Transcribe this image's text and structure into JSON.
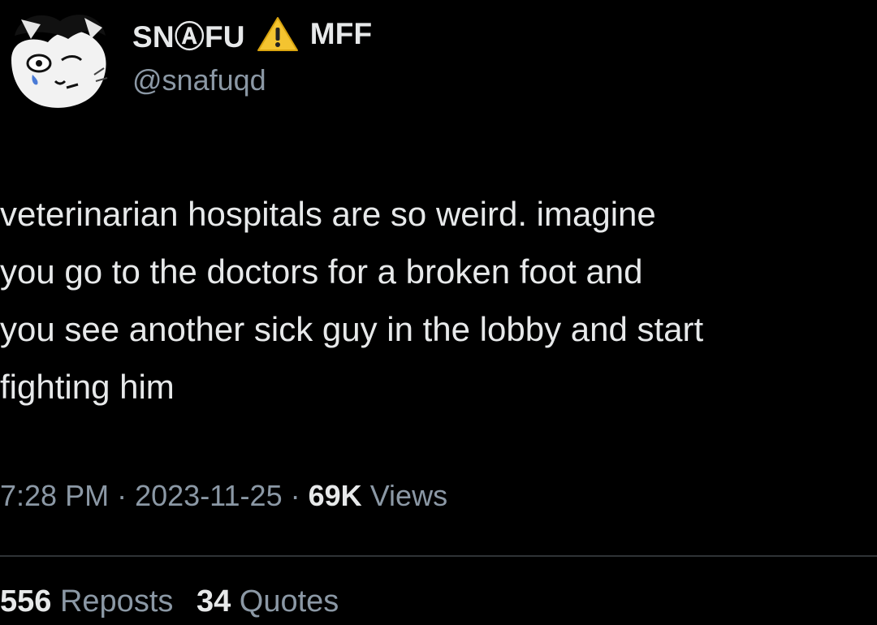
{
  "author": {
    "display_name": "SNⒶFU",
    "name_suffix": "MFF",
    "handle": "@snafuqd",
    "avatar_icon": "cat-avatar-icon",
    "badge_icon": "warning-icon",
    "badge_color": "#f4c430"
  },
  "tweet": {
    "lines": [
      "veterinarian hospitals are so weird. imagine",
      "you go to the doctors for a broken foot and",
      "you see another sick guy in the lobby and start",
      "fighting him"
    ]
  },
  "meta": {
    "time": "7:28 PM",
    "separator": "·",
    "date": "2023-11-25",
    "views_count": "69K",
    "views_label": "Views"
  },
  "stats": {
    "reposts_count": "556",
    "reposts_label": "Reposts",
    "quotes_count": "34",
    "quotes_label": "Quotes"
  },
  "colors": {
    "background": "#000000",
    "primary_text": "#e7e9ea",
    "secondary_text": "#8b98a5",
    "divider": "#2f3336"
  }
}
